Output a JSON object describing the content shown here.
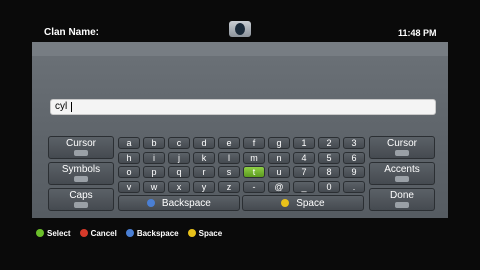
{
  "header": {
    "title": "Clan Name:",
    "clock": "11:48 PM"
  },
  "input": {
    "value": "cyl"
  },
  "left_keys": [
    {
      "label": "Cursor",
      "icon": "lb-icon"
    },
    {
      "label": "Symbols",
      "icon": "ls-icon"
    },
    {
      "label": "Caps",
      "icon": "lt-icon"
    }
  ],
  "right_keys": [
    {
      "label": "Cursor",
      "icon": "rb-icon"
    },
    {
      "label": "Accents",
      "icon": "rs-icon"
    },
    {
      "label": "Done",
      "icon": "start-icon"
    }
  ],
  "keyboard_rows": [
    [
      "a",
      "b",
      "c",
      "d",
      "e",
      "f",
      "g",
      "1",
      "2",
      "3"
    ],
    [
      "h",
      "i",
      "j",
      "k",
      "l",
      "m",
      "n",
      "4",
      "5",
      "6"
    ],
    [
      "o",
      "p",
      "q",
      "r",
      "s",
      "t",
      "u",
      "7",
      "8",
      "9"
    ],
    [
      "v",
      "w",
      "x",
      "y",
      "z",
      "-",
      "@",
      "_",
      "0",
      "."
    ]
  ],
  "selected_key": "t",
  "backspace": {
    "label": "Backspace",
    "button_color": "#4a7fd4"
  },
  "space": {
    "label": "Space",
    "button_color": "#e8c11a"
  },
  "footer": [
    {
      "label": "Select",
      "color": "#6bbf2a"
    },
    {
      "label": "Cancel",
      "color": "#d63a2a"
    },
    {
      "label": "Backspace",
      "color": "#4a7fd4"
    },
    {
      "label": "Space",
      "color": "#e8c11a"
    }
  ]
}
